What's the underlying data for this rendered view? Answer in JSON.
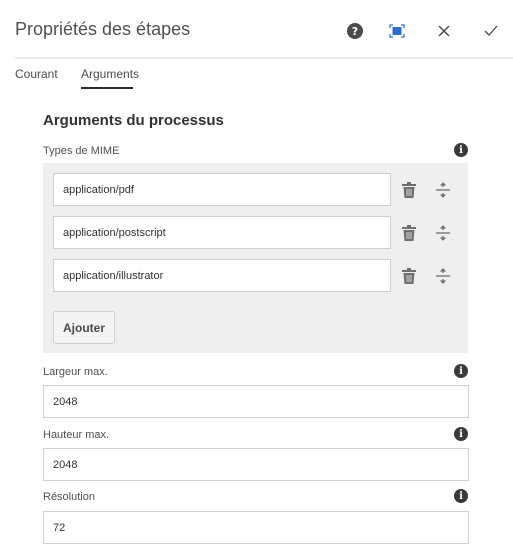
{
  "header": {
    "title": "Propriétés des étapes",
    "icons": [
      "help-icon",
      "fullscreen-icon",
      "close-icon",
      "check-icon"
    ]
  },
  "tabs": [
    {
      "label": "Courant"
    },
    {
      "label": "Arguments",
      "active": true
    }
  ],
  "section": {
    "title": "Arguments du processus"
  },
  "mime": {
    "label": "Types de MIME",
    "items": [
      "application/pdf",
      "application/postscript",
      "application/illustrator"
    ],
    "add_label": "Ajouter"
  },
  "fields": [
    {
      "label": "Largeur max.",
      "value": "2048"
    },
    {
      "label": "Hauteur max.",
      "value": "2048"
    },
    {
      "label": "Résolution",
      "value": "72"
    }
  ],
  "colors": {
    "accent": "#2d6fd1"
  }
}
